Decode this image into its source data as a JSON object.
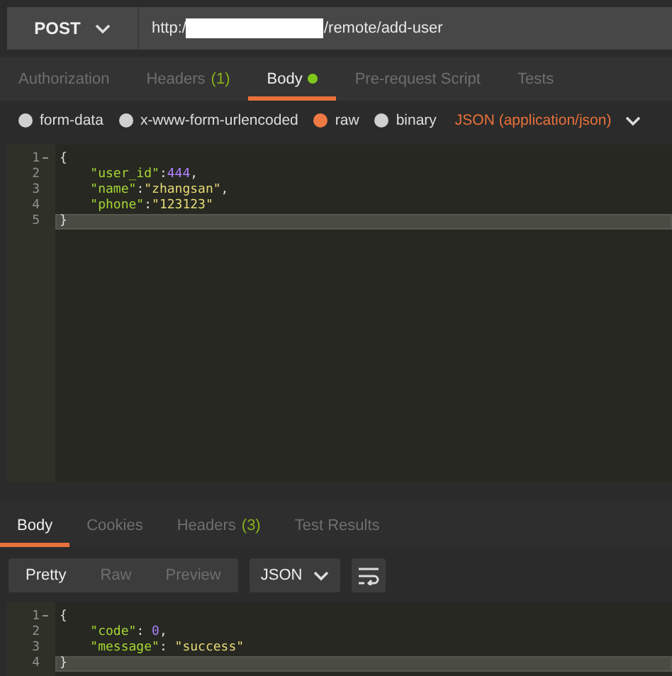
{
  "request": {
    "method": "POST",
    "url_prefix": "http:/",
    "url_redacted": true,
    "url_suffix": "/remote/add-user"
  },
  "request_tabs": [
    {
      "label": "Authorization",
      "selected": false
    },
    {
      "label": "Headers",
      "count": "(1)",
      "selected": false
    },
    {
      "label": "Body",
      "dot": true,
      "selected": true
    },
    {
      "label": "Pre-request Script",
      "selected": false
    },
    {
      "label": "Tests",
      "selected": false
    }
  ],
  "body_types": [
    {
      "label": "form-data",
      "selected": false
    },
    {
      "label": "x-www-form-urlencoded",
      "selected": false
    },
    {
      "label": "raw",
      "selected": true
    },
    {
      "label": "binary",
      "selected": false
    }
  ],
  "content_type": "JSON (application/json)",
  "request_body": [
    {
      "number": "1",
      "foldable": true,
      "current": false,
      "tokens": [
        {
          "text": "{",
          "kind": "punct"
        }
      ]
    },
    {
      "number": "2",
      "foldable": false,
      "current": false,
      "tokens": [
        {
          "text": "    \"user_id\"",
          "kind": "key"
        },
        {
          "text": ":",
          "kind": "punct"
        },
        {
          "text": "444",
          "kind": "number"
        },
        {
          "text": ",",
          "kind": "punct"
        }
      ]
    },
    {
      "number": "3",
      "foldable": false,
      "current": false,
      "tokens": [
        {
          "text": "    \"name\"",
          "kind": "key"
        },
        {
          "text": ":",
          "kind": "punct"
        },
        {
          "text": "\"zhangsan\"",
          "kind": "string"
        },
        {
          "text": ",",
          "kind": "punct"
        }
      ]
    },
    {
      "number": "4",
      "foldable": false,
      "current": false,
      "tokens": [
        {
          "text": "    \"phone\"",
          "kind": "key"
        },
        {
          "text": ":",
          "kind": "punct"
        },
        {
          "text": "\"123123\"",
          "kind": "string"
        }
      ]
    },
    {
      "number": "5",
      "foldable": false,
      "current": true,
      "tokens": [
        {
          "text": "}",
          "kind": "punct"
        }
      ]
    }
  ],
  "response_tabs": [
    {
      "label": "Body",
      "selected": true
    },
    {
      "label": "Cookies",
      "selected": false
    },
    {
      "label": "Headers",
      "count": "(3)",
      "selected": false
    },
    {
      "label": "Test Results",
      "selected": false
    }
  ],
  "view_modes": [
    {
      "label": "Pretty",
      "selected": true
    },
    {
      "label": "Raw",
      "selected": false
    },
    {
      "label": "Preview",
      "selected": false
    }
  ],
  "format": "JSON",
  "response_body": [
    {
      "number": "1",
      "foldable": true,
      "current": false,
      "tokens": [
        {
          "text": "{",
          "kind": "punct"
        }
      ]
    },
    {
      "number": "2",
      "foldable": false,
      "current": false,
      "tokens": [
        {
          "text": "    \"code\"",
          "kind": "key"
        },
        {
          "text": ": ",
          "kind": "punct"
        },
        {
          "text": "0",
          "kind": "number"
        },
        {
          "text": ",",
          "kind": "punct"
        }
      ]
    },
    {
      "number": "3",
      "foldable": false,
      "current": false,
      "tokens": [
        {
          "text": "    \"message\"",
          "kind": "key"
        },
        {
          "text": ": ",
          "kind": "punct"
        },
        {
          "text": "\"success\"",
          "kind": "string"
        }
      ]
    },
    {
      "number": "4",
      "foldable": false,
      "current": true,
      "tokens": [
        {
          "text": "}",
          "kind": "punct"
        }
      ]
    }
  ]
}
